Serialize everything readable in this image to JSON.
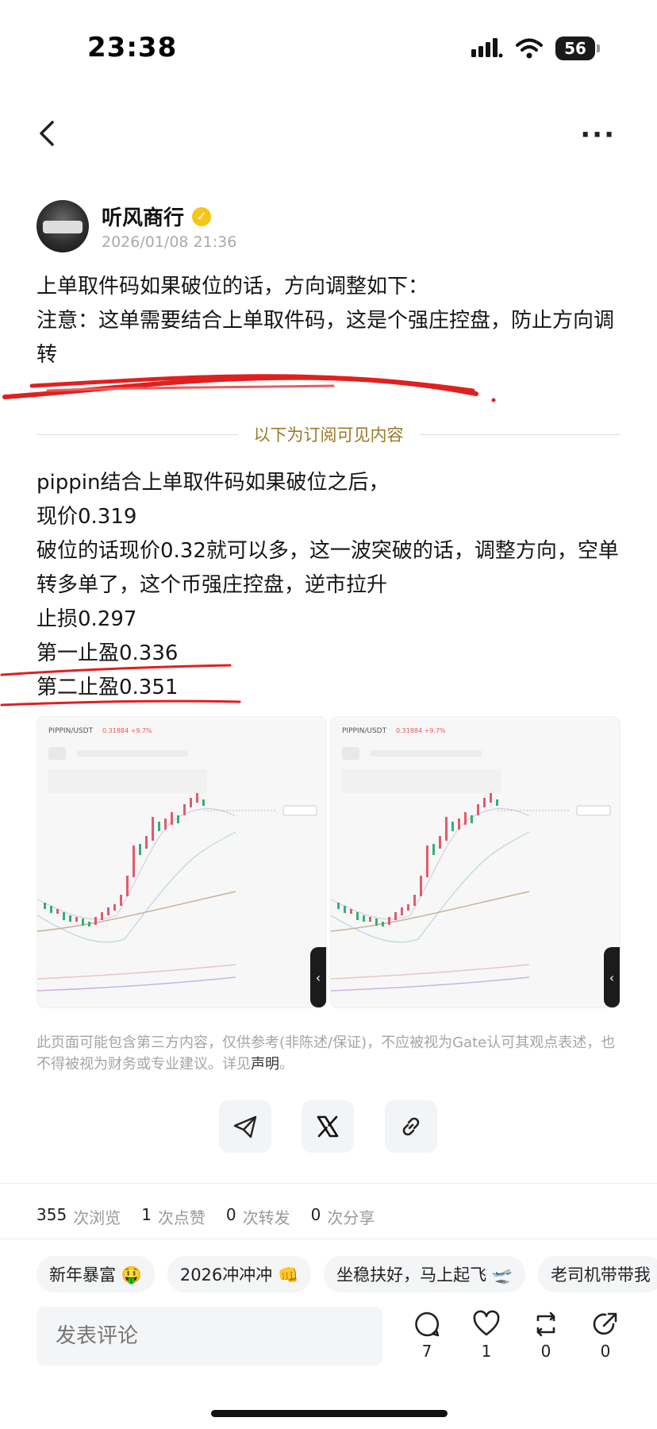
{
  "status_bar": {
    "time": "23:38",
    "battery": "56"
  },
  "nav": {
    "back_icon": "chevron-left-icon",
    "more_label": "···"
  },
  "author": {
    "name": "听风商行",
    "verified_icon": "verified-badge-icon",
    "date": "2026/01/08 21:36"
  },
  "post": {
    "intro": "上单取件码如果破位的话，方向调整如下：",
    "note": "注意：这单需要结合上单取件码，这是个强庄控盘，防止方向调转",
    "subscriber_divider": "以下为订阅可见内容",
    "lines": [
      "pippin结合上单取件码如果破位之后，",
      "现价0.319",
      "破位的话现价0.32就可以多，这一波突破的话，调整方向，空单转多单了，这个币强庄控盘，逆市拉升",
      "止损0.297",
      "第一止盈0.336",
      "第二止盈0.351"
    ]
  },
  "images": [
    {
      "pair": "PIPPIN/USDT",
      "change": "0.31884 +9.7%"
    },
    {
      "pair": "PIPPIN/USDT",
      "change": "0.31884 +9.7%"
    }
  ],
  "disclaimer": {
    "text": "此页面可能包含第三方内容，仅供参考(非陈述/保证)，不应被视为Gate认可其观点表述，也不得被视为财务或专业建议。详见",
    "link": "声明",
    "end": "。"
  },
  "share": {
    "icons": [
      "telegram-icon",
      "x-icon",
      "link-icon"
    ]
  },
  "stats": {
    "views": "355",
    "views_label": "次浏览",
    "likes": "1",
    "likes_label": "次点赞",
    "reposts": "0",
    "reposts_label": "次转发",
    "shares": "0",
    "shares_label": "次分享"
  },
  "tags": [
    "新年暴富 🤑",
    "2026冲冲冲 👊",
    "坐稳扶好，马上起飞 🛫",
    "老司机带带我"
  ],
  "comment": {
    "placeholder": "发表评论"
  },
  "actions": [
    {
      "icon": "comment-icon",
      "count": "7"
    },
    {
      "icon": "heart-icon",
      "count": "1"
    },
    {
      "icon": "repost-icon",
      "count": "0"
    },
    {
      "icon": "share-icon",
      "count": "0"
    }
  ],
  "colors": {
    "accent_gold": "#9a7a2a",
    "annotation_red": "#e02020",
    "verified": "#f5c518"
  }
}
